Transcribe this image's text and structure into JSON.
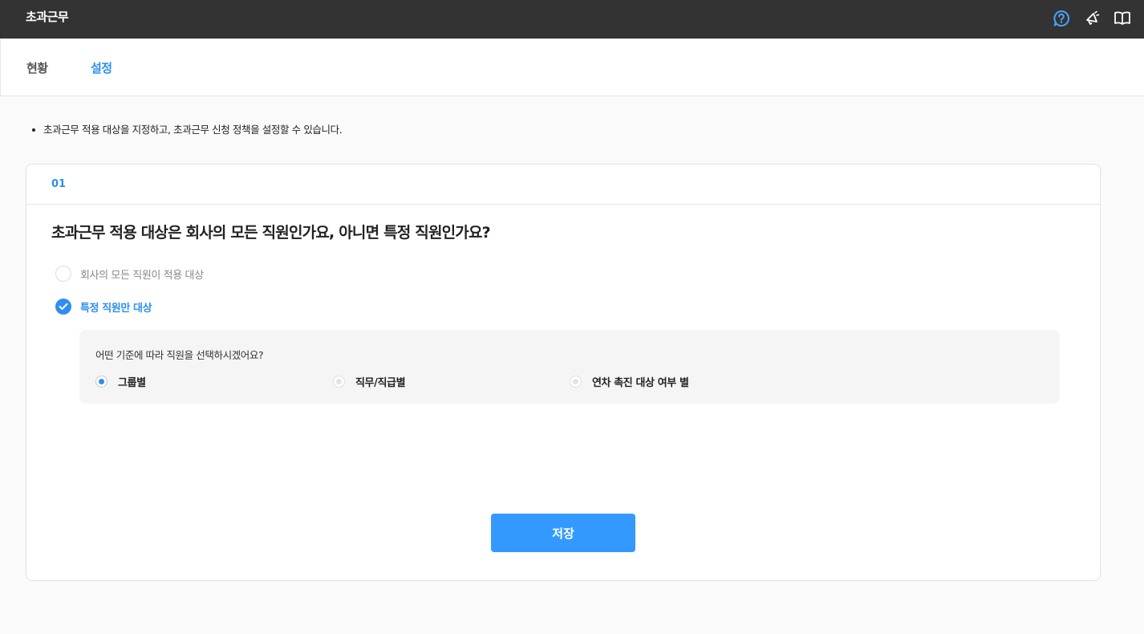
{
  "header": {
    "app_title": "초과근무",
    "icons": [
      "help-circle-icon",
      "megaphone-icon",
      "book-open-icon"
    ],
    "accent_color": "#2e8fef"
  },
  "tabs": [
    {
      "label": "현황",
      "active": false
    },
    {
      "label": "설정",
      "active": true
    }
  ],
  "notice": "초과근무 적용 대상을 지정하고, 초과근무 신청 정책을 설정할 수 있습니다.",
  "section": {
    "step": "01",
    "question": "초과근무 적용 대상은 회사의 모든 직원인가요, 아니면 특정 직원인가요?",
    "options": [
      {
        "label": "회사의 모든 직원이 적용 대상",
        "selected": false
      },
      {
        "label": "특정 직원만 대상",
        "selected": true
      }
    ],
    "sub": {
      "question": "어떤 기준에 따라 직원을 선택하시겠어요?",
      "choices": [
        {
          "label": "그룹별",
          "selected": true
        },
        {
          "label": "직무/직급별",
          "selected": false
        },
        {
          "label": "연차 촉진 대상 여부 별",
          "selected": false
        }
      ]
    }
  },
  "save_label": "저장"
}
